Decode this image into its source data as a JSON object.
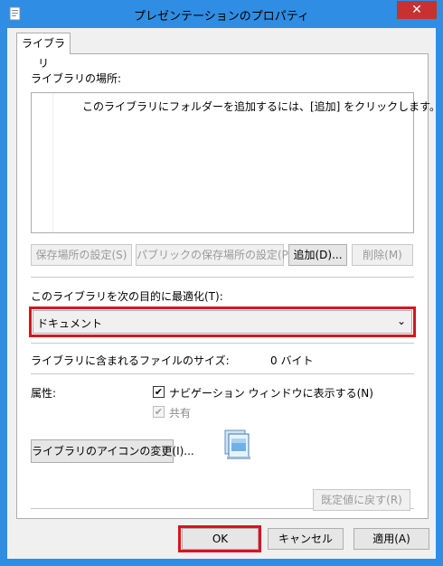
{
  "window": {
    "title": "プレゼンテーションのプロパティ",
    "close_label": "✕"
  },
  "tabs": [
    {
      "label": "ライブラリ"
    }
  ],
  "library": {
    "locations_label": "ライブラリの場所:",
    "empty_message": "このライブラリにフォルダーを追加するには、[追加] をクリックします。",
    "save_location_button": "保存場所の設定(S)",
    "public_save_location_button": "パブリックの保存場所の設定(P)",
    "add_button": "追加(D)...",
    "remove_button": "削除(M)",
    "optimize_label": "このライブラリを次の目的に最適化(T):",
    "optimize_value": "ドキュメント",
    "size_label": "ライブラリに含まれるファイルのサイズ:",
    "size_value": "0 バイト",
    "attributes_label": "属性:",
    "show_in_nav_label": "ナビゲーション ウィンドウに表示する(N)",
    "show_in_nav_checked": true,
    "shared_label": "共有",
    "shared_checked": true,
    "change_icon_button": "ライブラリのアイコンの変更(I)...",
    "restore_defaults_button": "既定値に戻す(R)"
  },
  "footer": {
    "ok_button": "OK",
    "cancel_button": "キャンセル",
    "apply_button": "適用(A)"
  },
  "colors": {
    "frame": "#2f8de3",
    "highlight": "#d8141f",
    "close": "#c7312f"
  }
}
